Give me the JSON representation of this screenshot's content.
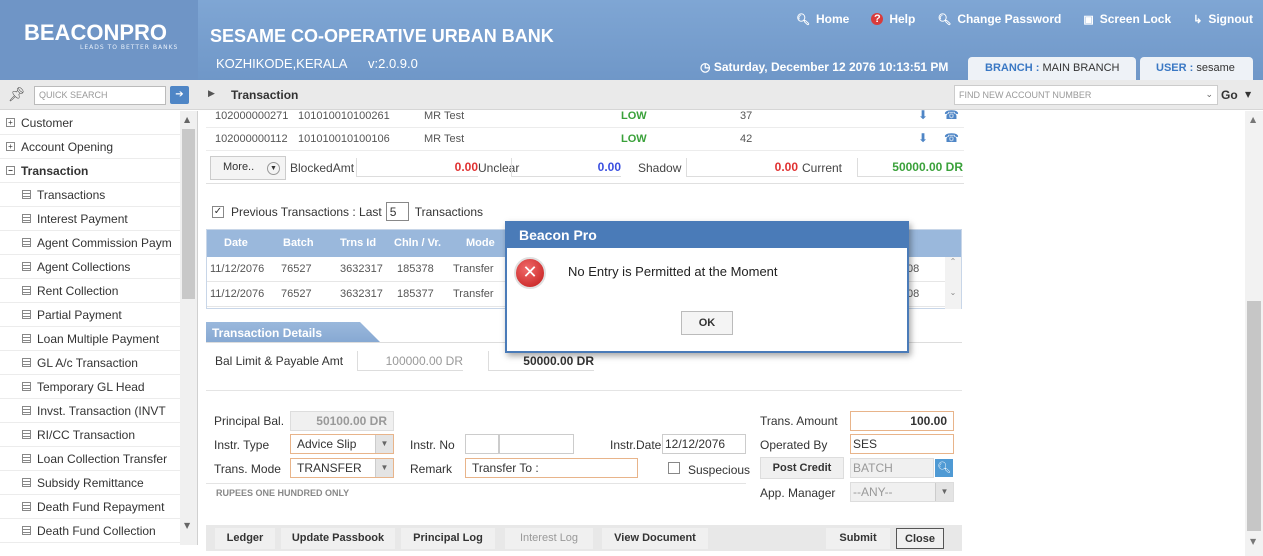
{
  "header": {
    "logo_text": "BEACONPRO",
    "logo_tagline": "LEADS TO BETTER BANKS",
    "bank_name": "SESAME CO-OPERATIVE URBAN BANK",
    "location": "KOZHIKODE,KERALA",
    "version": "v:2.0.9.0",
    "datetime": "Saturday, December 12 2076 10:13:51 PM",
    "links": {
      "home": "Home",
      "help": "Help",
      "change_password": "Change Password",
      "screen_lock": "Screen Lock",
      "signout": "Signout"
    },
    "branch_key": "BRANCH : ",
    "branch_value": "MAIN BRANCH",
    "user_key": "USER : ",
    "user_value": "sesame"
  },
  "toolbar": {
    "quick_search_placeholder": "QUICK SEARCH",
    "breadcrumb": "Transaction",
    "find_account_placeholder": "FIND NEW ACCOUNT NUMBER",
    "go_label": "Go"
  },
  "sidebar": {
    "top_items": [
      "Customer",
      "Account Opening",
      "Transaction"
    ],
    "sub_items": [
      "Transactions",
      "Interest Payment",
      "Agent Commission Paym",
      "Agent Collections",
      "Rent Collection",
      "Partial Payment",
      "Loan Multiple Payment",
      "GL A/c Transaction",
      "Temporary GL Head",
      "Invst. Transaction (INVT",
      "RI/CC Transaction",
      "Loan Collection Transfer",
      "Subsidy Remittance",
      "Death Fund Repayment",
      "Death Fund Collection"
    ]
  },
  "accounts": [
    {
      "number": "102000000271",
      "ref": "101010010100261",
      "name": "MR Test",
      "risk": "LOW",
      "count": "37"
    },
    {
      "number": "102000000112",
      "ref": "101010010100106",
      "name": "MR Test",
      "risk": "LOW",
      "count": "42"
    }
  ],
  "balances": {
    "more_label": "More..",
    "blocked_label": "BlockedAmt",
    "blocked_value": "0.00",
    "unclear_label": "Unclear",
    "unclear_value": "0.00",
    "shadow_label": "Shadow",
    "shadow_value": "0.00",
    "current_label": "Current",
    "current_value": "50000.00 DR"
  },
  "prev_tx": {
    "label": "Previous Transactions : Last",
    "count": "5",
    "suffix": "Transactions"
  },
  "tx_table": {
    "headers": [
      "Date",
      "Batch",
      "Trns Id",
      "Chln / Vr.",
      "Mode"
    ],
    "rows": [
      {
        "date": "11/12/2076",
        "batch": "76527",
        "trns_id": "3632317",
        "chln": "185378",
        "mode": "Transfer",
        "tail": "08"
      },
      {
        "date": "11/12/2076",
        "batch": "76527",
        "trns_id": "3632317",
        "chln": "185377",
        "mode": "Transfer",
        "tail": "08"
      }
    ]
  },
  "details": {
    "section_title": "Transaction Details",
    "bal_limit_label": "Bal Limit & Payable Amt",
    "bal_limit_value": "100000.00 DR",
    "payable_value": "50000.00 DR",
    "principal_label": "Principal Bal.",
    "principal_value": "50100.00 DR",
    "instr_type_label": "Instr. Type",
    "instr_type_value": "Advice Slip",
    "instr_no_label": "Instr. No",
    "instr_date_label": "Instr.Date",
    "instr_date_value": "12/12/2076",
    "trans_mode_label": "Trans. Mode",
    "trans_mode_value": "TRANSFER",
    "remark_label": "Remark",
    "remark_value": "Transfer To :",
    "suspecious_label": "Suspecious",
    "rupees_text": "RUPEES ONE HUNDRED ONLY",
    "trans_amount_label": "Trans. Amount",
    "trans_amount_value": "100.00",
    "operated_by_label": "Operated By",
    "operated_by_value": "SES",
    "post_credit_label": "Post Credit",
    "batch_placeholder": "BATCH",
    "app_manager_label": "App. Manager",
    "app_manager_value": "--ANY--"
  },
  "buttons": {
    "ledger": "Ledger",
    "update_passbook": "Update Passbook",
    "principal_log": "Principal Log",
    "interest_log": "Interest Log",
    "view_document": "View Document",
    "submit": "Submit",
    "close": "Close"
  },
  "dialog": {
    "title": "Beacon Pro",
    "message": "No Entry is Permitted at the Moment",
    "ok_label": "OK"
  },
  "colors": {
    "header_blue": "#7fa6d4",
    "dialog_blue": "#4a7bb8",
    "low_green": "#3aa13a",
    "amount_red": "#e03131"
  }
}
